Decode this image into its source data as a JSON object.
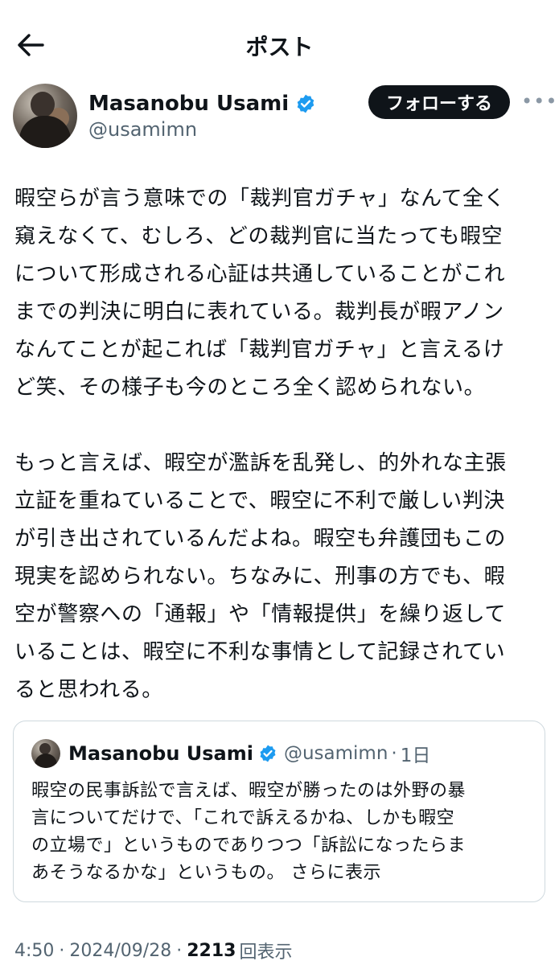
{
  "header": {
    "title": "ポスト",
    "back_icon": "arrow-left-icon"
  },
  "author": {
    "name": "Masanobu Usami",
    "handle": "@usamimn",
    "verified_color": "#1d9bf0",
    "follow_label": "フォローする",
    "more_label": "•••"
  },
  "post": {
    "paragraphs": [
      {
        "lines": [
          "暇空らが言う意味での「裁判官ガチャ」なんて全く",
          "窺えなくて、むしろ、どの裁判官に当たっても暇空",
          "について形成される心証は共通していることがこれ",
          "までの判決に明白に表れている。裁判長が暇アノン",
          "なんてことが起これば「裁判官ガチャ」と言えるけ",
          "ど笑、その様子も今のところ全く認められない。"
        ]
      },
      {
        "lines": [
          "もっと言えば、暇空が濫訴を乱発し、的外れな主張",
          "立証を重ねていることで、暇空に不利で厳しい判決",
          "が引き出されているんだよね。暇空も弁護団もこの",
          "現実を認められない。ちなみに、刑事の方でも、暇",
          "空が警察への「通報」や「情報提供」を繰り返して",
          "いることは、暇空に不利な事情として記録されてい",
          "ると思われる。"
        ]
      }
    ]
  },
  "quote": {
    "name": "Masanobu Usami",
    "handle": "@usamimn",
    "separator": "·",
    "time": "1日",
    "lines": [
      "暇空の民事訴訟で言えば、暇空が勝ったのは外野の暴",
      "言についてだけで、「これで訴えるかね、しかも暇空",
      "の立場で」というものでありつつ「訴訟になったらま"
    ],
    "last_line": "あそうなるかな」というもの。",
    "show_more": "さらに表示"
  },
  "meta": {
    "time": "4:50",
    "separator": "·",
    "date": "2024/09/28",
    "views_count": "2213",
    "views_label": "回表示"
  }
}
